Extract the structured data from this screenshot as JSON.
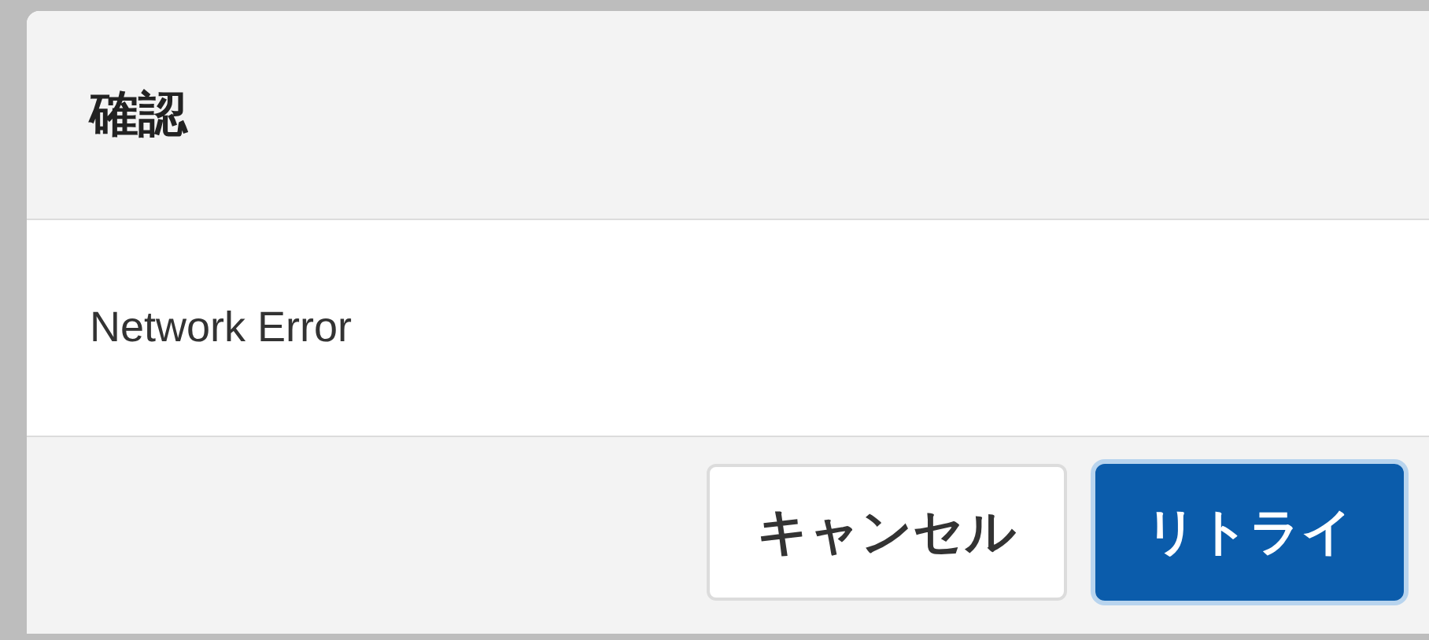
{
  "dialog": {
    "title": "確認",
    "message": "Network Error",
    "buttons": [
      {
        "label": "キャンセル",
        "kind": "neutral"
      },
      {
        "label": "リトライ",
        "kind": "brand"
      }
    ]
  }
}
